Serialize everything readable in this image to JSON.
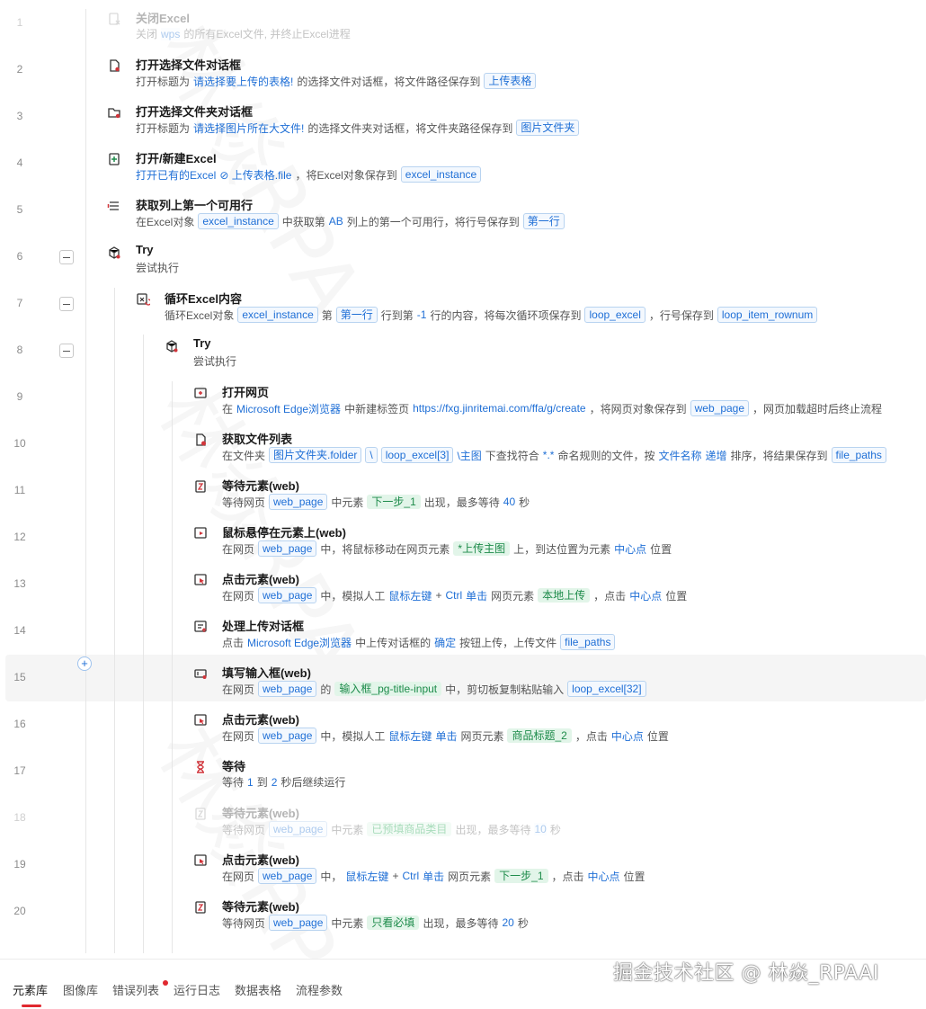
{
  "colors": {
    "accent": "#1f6fd6",
    "element_green": "#1d8b4a",
    "icon_red": "#d1343a",
    "tab_underline": "#e0282f"
  },
  "steps": [
    {
      "no": "1",
      "icon": "close-excel-icon",
      "title": "关闭Excel",
      "disabled": true,
      "desc": [
        {
          "k": "t",
          "v": "关闭"
        },
        {
          "k": "h",
          "v": "wps"
        },
        {
          "k": "t",
          "v": "的所有Excel文件, 并终止Excel进程"
        }
      ]
    },
    {
      "no": "2",
      "icon": "file-dialog-icon",
      "title": "打开选择文件对话框",
      "desc": [
        {
          "k": "t",
          "v": "打开标题为"
        },
        {
          "k": "h",
          "v": "请选择要上传的表格!"
        },
        {
          "k": "t",
          "v": "的选择文件对话框，将文件路径保存到"
        },
        {
          "k": "v",
          "v": "上传表格"
        }
      ]
    },
    {
      "no": "3",
      "icon": "folder-dialog-icon",
      "title": "打开选择文件夹对话框",
      "desc": [
        {
          "k": "t",
          "v": "打开标题为"
        },
        {
          "k": "h",
          "v": "请选择图片所在大文件!"
        },
        {
          "k": "t",
          "v": "的选择文件夹对话框，将文件夹路径保存到"
        },
        {
          "k": "v",
          "v": "图片文件夹"
        }
      ]
    },
    {
      "no": "4",
      "icon": "open-excel-icon",
      "title": "打开/新建Excel",
      "desc": [
        {
          "k": "h",
          "v": "打开已有的Excel"
        },
        {
          "k": "h",
          "v": "⊘ 上传表格.file"
        },
        {
          "k": "t",
          "v": "，将Excel对象保存到"
        },
        {
          "k": "v",
          "v": "excel_instance"
        }
      ]
    },
    {
      "no": "5",
      "icon": "column-icon",
      "title": "获取列上第一个可用行",
      "desc": [
        {
          "k": "t",
          "v": "在Excel对象"
        },
        {
          "k": "v",
          "v": "excel_instance"
        },
        {
          "k": "t",
          "v": "中获取第"
        },
        {
          "k": "h",
          "v": "AB"
        },
        {
          "k": "t",
          "v": "列上的第一个可用行，将行号保存到"
        },
        {
          "k": "v",
          "v": "第一行"
        }
      ]
    },
    {
      "no": "6",
      "icon": "try-cube-icon",
      "title": "Try",
      "collapsible": true,
      "desc": [
        {
          "k": "t",
          "v": "尝试执行"
        }
      ]
    },
    {
      "no": "7",
      "icon": "loop-excel-icon",
      "title": "循环Excel内容",
      "collapsible": true,
      "desc": [
        {
          "k": "t",
          "v": "循环Excel对象"
        },
        {
          "k": "v",
          "v": "excel_instance"
        },
        {
          "k": "t",
          "v": "第"
        },
        {
          "k": "v",
          "v": "第一行"
        },
        {
          "k": "t",
          "v": "行到第"
        },
        {
          "k": "h",
          "v": "-1"
        },
        {
          "k": "t",
          "v": "行的内容，将每次循环项保存到"
        },
        {
          "k": "v",
          "v": "loop_excel"
        },
        {
          "k": "t",
          "v": "，行号保存到"
        },
        {
          "k": "v",
          "v": "loop_item_rownum"
        }
      ]
    },
    {
      "no": "8",
      "icon": "try-cube-icon",
      "title": "Try",
      "collapsible": true,
      "desc": [
        {
          "k": "t",
          "v": "尝试执行"
        }
      ]
    },
    {
      "no": "9",
      "icon": "open-webpage-icon",
      "title": "打开网页",
      "desc": [
        {
          "k": "t",
          "v": "在"
        },
        {
          "k": "h",
          "v": "Microsoft Edge浏览器"
        },
        {
          "k": "t",
          "v": "中新建标签页"
        },
        {
          "k": "h",
          "v": "https://fxg.jinritemai.com/ffa/g/create"
        },
        {
          "k": "t",
          "v": "，将网页对象保存到"
        },
        {
          "k": "v",
          "v": "web_page"
        },
        {
          "k": "t",
          "v": "，网页加载超时后终止流程"
        }
      ]
    },
    {
      "no": "10",
      "icon": "file-list-icon",
      "title": "获取文件列表",
      "desc": [
        {
          "k": "t",
          "v": "在文件夹"
        },
        {
          "k": "v",
          "v": "图片文件夹.folder"
        },
        {
          "k": "v",
          "v": "\\"
        },
        {
          "k": "v",
          "v": "loop_excel[3]"
        },
        {
          "k": "h",
          "v": "\\主图"
        },
        {
          "k": "t",
          "v": "下查找符合"
        },
        {
          "k": "h",
          "v": "*.*"
        },
        {
          "k": "t",
          "v": "命名规则的文件，按"
        },
        {
          "k": "h",
          "v": "文件名称"
        },
        {
          "k": "h",
          "v": "递增"
        },
        {
          "k": "t",
          "v": "排序，将结果保存到"
        },
        {
          "k": "v",
          "v": "file_paths"
        }
      ]
    },
    {
      "no": "11",
      "icon": "wait-element-icon",
      "title": "等待元素(web)",
      "desc": [
        {
          "k": "t",
          "v": "等待网页"
        },
        {
          "k": "v",
          "v": "web_page"
        },
        {
          "k": "t",
          "v": "中元素"
        },
        {
          "k": "e",
          "v": "下一步_1"
        },
        {
          "k": "t",
          "v": "出现，最多等待"
        },
        {
          "k": "h",
          "v": "40"
        },
        {
          "k": "t",
          "v": "秒"
        }
      ]
    },
    {
      "no": "12",
      "icon": "hover-icon",
      "title": "鼠标悬停在元素上(web)",
      "desc": [
        {
          "k": "t",
          "v": "在网页"
        },
        {
          "k": "v",
          "v": "web_page"
        },
        {
          "k": "t",
          "v": "中，将鼠标移动在网页元素"
        },
        {
          "k": "e",
          "v": "*上传主图"
        },
        {
          "k": "t",
          "v": "上，到达位置为元素"
        },
        {
          "k": "h",
          "v": "中心点"
        },
        {
          "k": "t",
          "v": "位置"
        }
      ]
    },
    {
      "no": "13",
      "icon": "click-element-icon",
      "title": "点击元素(web)",
      "desc": [
        {
          "k": "t",
          "v": "在网页"
        },
        {
          "k": "v",
          "v": "web_page"
        },
        {
          "k": "t",
          "v": "中，模拟人工"
        },
        {
          "k": "h",
          "v": "鼠标左键"
        },
        {
          "k": "t",
          "v": "+"
        },
        {
          "k": "h",
          "v": "Ctrl"
        },
        {
          "k": "h",
          "v": "单击"
        },
        {
          "k": "t",
          "v": "网页元素"
        },
        {
          "k": "e",
          "v": "本地上传"
        },
        {
          "k": "t",
          "v": "，点击"
        },
        {
          "k": "h",
          "v": "中心点"
        },
        {
          "k": "t",
          "v": "位置"
        }
      ]
    },
    {
      "no": "14",
      "icon": "upload-dialog-icon",
      "title": "处理上传对话框",
      "desc": [
        {
          "k": "t",
          "v": "点击"
        },
        {
          "k": "h",
          "v": "Microsoft Edge浏览器"
        },
        {
          "k": "t",
          "v": "中上传对话框的"
        },
        {
          "k": "h",
          "v": "确定"
        },
        {
          "k": "t",
          "v": "按钮上传，上传文件"
        },
        {
          "k": "v",
          "v": "file_paths"
        }
      ]
    },
    {
      "no": "15",
      "icon": "input-field-icon",
      "title": "填写输入框(web)",
      "highlighted": true,
      "desc": [
        {
          "k": "t",
          "v": "在网页"
        },
        {
          "k": "v",
          "v": "web_page"
        },
        {
          "k": "t",
          "v": "的"
        },
        {
          "k": "e",
          "v": "输入框_pg-title-input"
        },
        {
          "k": "t",
          "v": "中，剪切板复制粘贴输入"
        },
        {
          "k": "v",
          "v": "loop_excel[32]"
        }
      ]
    },
    {
      "no": "16",
      "icon": "click-element-icon",
      "title": "点击元素(web)",
      "desc": [
        {
          "k": "t",
          "v": "在网页"
        },
        {
          "k": "v",
          "v": "web_page"
        },
        {
          "k": "t",
          "v": "中，模拟人工"
        },
        {
          "k": "h",
          "v": "鼠标左键"
        },
        {
          "k": "h",
          "v": "单击"
        },
        {
          "k": "t",
          "v": "网页元素"
        },
        {
          "k": "e",
          "v": "商品标题_2"
        },
        {
          "k": "t",
          "v": "，点击"
        },
        {
          "k": "h",
          "v": "中心点"
        },
        {
          "k": "t",
          "v": "位置"
        }
      ]
    },
    {
      "no": "17",
      "icon": "hourglass-icon",
      "title": "等待",
      "desc": [
        {
          "k": "t",
          "v": "等待"
        },
        {
          "k": "h",
          "v": "1"
        },
        {
          "k": "t",
          "v": "到"
        },
        {
          "k": "h",
          "v": "2"
        },
        {
          "k": "t",
          "v": "秒后继续运行"
        }
      ]
    },
    {
      "no": "18",
      "icon": "wait-element-icon",
      "title": "等待元素(web)",
      "disabled": true,
      "desc": [
        {
          "k": "t",
          "v": "等待网页"
        },
        {
          "k": "v",
          "v": "web_page"
        },
        {
          "k": "t",
          "v": "中元素"
        },
        {
          "k": "e",
          "v": "已预填商品类目"
        },
        {
          "k": "t",
          "v": "出现，最多等待"
        },
        {
          "k": "h",
          "v": "10"
        },
        {
          "k": "t",
          "v": "秒"
        }
      ]
    },
    {
      "no": "19",
      "icon": "click-element-icon",
      "title": "点击元素(web)",
      "desc": [
        {
          "k": "t",
          "v": "在网页"
        },
        {
          "k": "v",
          "v": "web_page"
        },
        {
          "k": "t",
          "v": "中，"
        },
        {
          "k": "h",
          "v": "鼠标左键"
        },
        {
          "k": "t",
          "v": "+"
        },
        {
          "k": "h",
          "v": "Ctrl"
        },
        {
          "k": "h",
          "v": "单击"
        },
        {
          "k": "t",
          "v": "网页元素"
        },
        {
          "k": "e",
          "v": "下一步_1"
        },
        {
          "k": "t",
          "v": "，点击"
        },
        {
          "k": "h",
          "v": "中心点"
        },
        {
          "k": "t",
          "v": "位置"
        }
      ]
    },
    {
      "no": "20",
      "icon": "wait-element-icon",
      "title": "等待元素(web)",
      "desc": [
        {
          "k": "t",
          "v": "等待网页"
        },
        {
          "k": "v",
          "v": "web_page"
        },
        {
          "k": "t",
          "v": "中元素"
        },
        {
          "k": "e",
          "v": "只看必填"
        },
        {
          "k": "t",
          "v": "出现，最多等待"
        },
        {
          "k": "h",
          "v": "20"
        },
        {
          "k": "t",
          "v": "秒"
        }
      ]
    }
  ],
  "bottom_tabs": [
    {
      "label": "元素库",
      "active": true
    },
    {
      "label": "图像库"
    },
    {
      "label": "错误列表",
      "badge": true
    },
    {
      "label": "运行日志"
    },
    {
      "label": "数据表格"
    },
    {
      "label": "流程参数"
    }
  ],
  "watermark_text": "掘金技术社区 @ 林焱_RPAAI"
}
